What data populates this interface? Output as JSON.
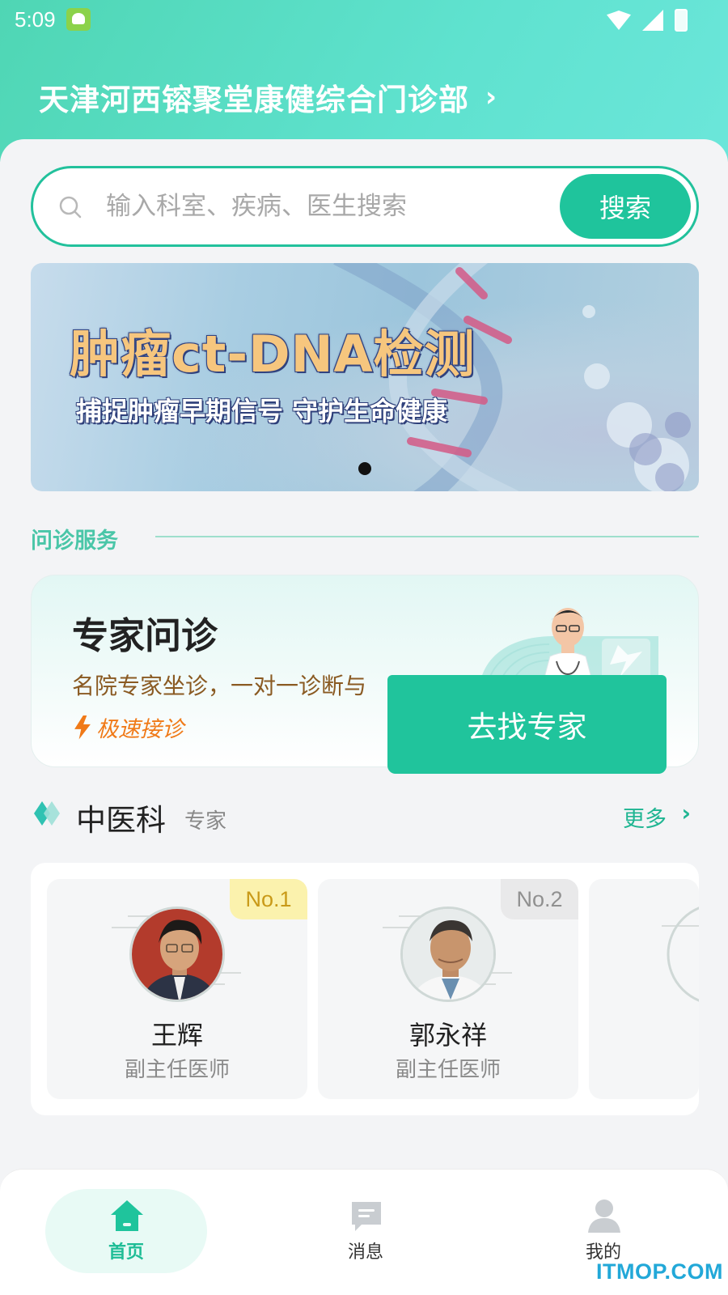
{
  "status_bar": {
    "time": "5:09"
  },
  "header": {
    "clinic_name": "天津河西镕聚堂康健综合门诊部",
    "chevron": "›"
  },
  "search": {
    "placeholder": "输入科室、疾病、医生搜索",
    "button_label": "搜索"
  },
  "banner": {
    "title": "肿瘤ct-DNA检测",
    "subtitle": "捕捉肿瘤早期信号 守护生命健康",
    "active_index": 0,
    "count": 1
  },
  "consult_section": {
    "title": "问诊服务"
  },
  "expert_card": {
    "title": "专家问诊",
    "description": "名院专家坐诊，一对一诊断与",
    "fast_label": "极速接诊",
    "button_label": "去找专家"
  },
  "department": {
    "name": "中医科",
    "tag": "专家",
    "more_label": "更多"
  },
  "doctors": [
    {
      "rank": "No.1",
      "name": "王辉",
      "title": "副主任医师"
    },
    {
      "rank": "No.2",
      "name": "郭永祥",
      "title": "副主任医师"
    }
  ],
  "tabbar": {
    "items": [
      {
        "label": "首页",
        "icon": "home-icon",
        "active": true
      },
      {
        "label": "消息",
        "icon": "message-icon",
        "active": false
      },
      {
        "label": "我的",
        "icon": "user-icon",
        "active": false
      }
    ]
  },
  "watermark": "ITMOP.COM",
  "colors": {
    "primary": "#1fc49c",
    "header_gradient_start": "#4fd6b4",
    "header_gradient_end": "#6be6da",
    "accent_orange": "#f07a18"
  }
}
